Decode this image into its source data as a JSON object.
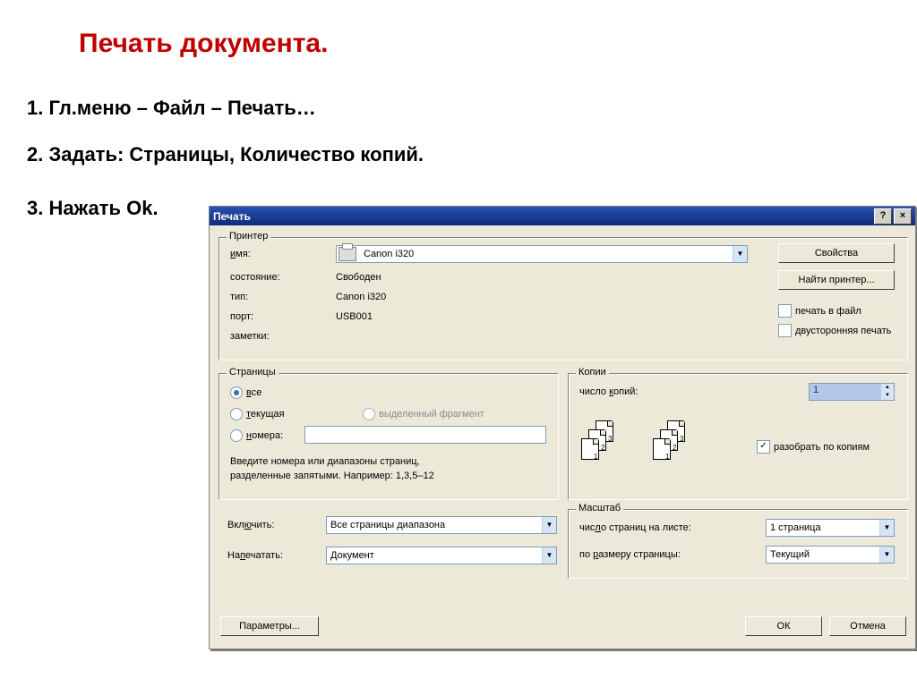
{
  "heading": "Печать документа.",
  "steps": {
    "s1": "1. Гл.меню – Файл – Печать…",
    "s2": "2. Задать: Страницы, Количество копий.",
    "s3": "3. Нажать Ok."
  },
  "dialog": {
    "title": "Печать",
    "help_btn": "?",
    "close_btn": "×",
    "printer": {
      "legend": "Принтер",
      "name_lbl": "имя:",
      "name_val": "Canon i320",
      "status_lbl": "состояние:",
      "status_val": "Свободен",
      "type_lbl": "тип:",
      "type_val": "Canon i320",
      "port_lbl": "порт:",
      "port_val": "USB001",
      "notes_lbl": "заметки:",
      "properties_btn": "Свойства",
      "find_btn": "Найти принтер...",
      "to_file": "печать в файл",
      "duplex": "двусторонняя печать"
    },
    "pages": {
      "legend": "Страницы",
      "all": "все",
      "current": "текущая",
      "selection": "выделенный фрагмент",
      "numbers": "номера:",
      "hint1": "Введите номера или диапазоны страниц,",
      "hint2": "разделенные запятыми. Например: 1,3,5–12"
    },
    "copies": {
      "legend": "Копии",
      "count_lbl": "число копий:",
      "count_val": "1",
      "collate": "разобрать по копиям"
    },
    "include": {
      "include_lbl": "Включить:",
      "include_val": "Все страницы диапазона",
      "print_lbl": "Напечатать:",
      "print_val": "Документ"
    },
    "scale": {
      "legend": "Масштаб",
      "per_sheet_lbl": "число страниц на листе:",
      "per_sheet_val": "1 страница",
      "fit_lbl": "по размеру страницы:",
      "fit_val": "Текущий"
    },
    "buttons": {
      "params": "Параметры...",
      "ok": "ОК",
      "cancel": "Отмена"
    }
  }
}
